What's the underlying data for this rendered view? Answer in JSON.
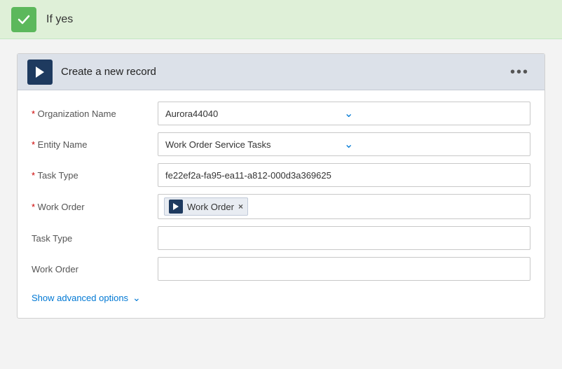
{
  "header": {
    "title": "If yes",
    "check_label": "✓"
  },
  "card": {
    "title": "Create a new record",
    "more_icon": "•••",
    "fields": [
      {
        "label": "Organization Name",
        "required": true,
        "type": "dropdown",
        "value": "Aurora44040"
      },
      {
        "label": "Entity Name",
        "required": true,
        "type": "dropdown",
        "value": "Work Order Service Tasks"
      },
      {
        "label": "Task Type",
        "required": true,
        "type": "text",
        "value": "fe22ef2a-fa95-ea11-a812-000d3a369625"
      },
      {
        "label": "Work Order",
        "required": true,
        "type": "tag",
        "tag_label": "Work Order"
      },
      {
        "label": "Task Type",
        "required": false,
        "type": "empty",
        "value": ""
      },
      {
        "label": "Work Order",
        "required": false,
        "type": "empty",
        "value": ""
      }
    ],
    "show_advanced": "Show advanced options"
  },
  "colors": {
    "accent_blue": "#0078d4",
    "dark_navy": "#1e3a5f",
    "green": "#5cb85c",
    "required_red": "#cc0000"
  }
}
